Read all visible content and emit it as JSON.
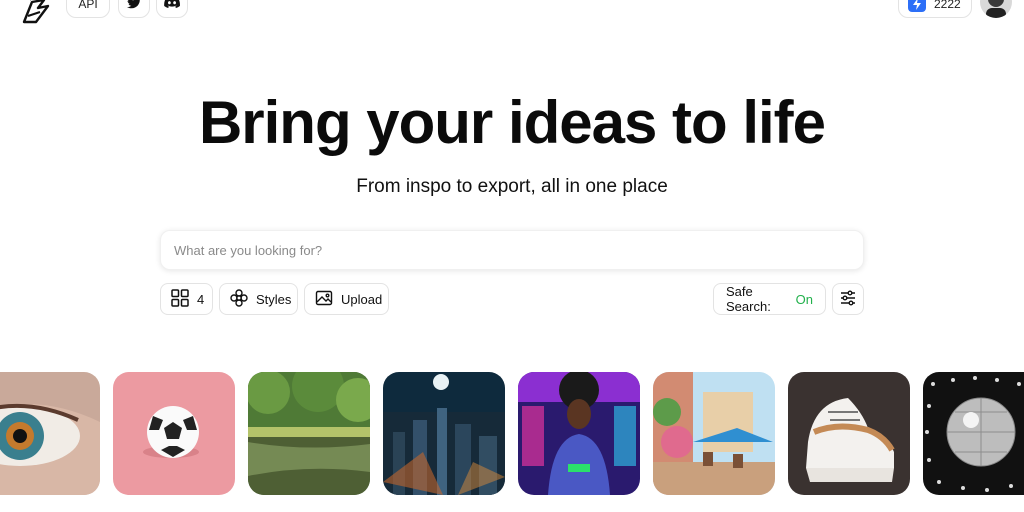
{
  "nav": {
    "api_label": "API",
    "twitter_icon": "twitter-icon",
    "discord_icon": "discord-icon",
    "credits": "2222",
    "credits_icon": "lightning-icon"
  },
  "hero": {
    "title": "Bring your ideas to life",
    "subtitle": "From inspo to export, all in one place"
  },
  "search": {
    "placeholder": "What are you looking for?",
    "value": ""
  },
  "toolbar": {
    "count": "4",
    "styles_label": "Styles",
    "upload_label": "Upload",
    "safe_search_label": "Safe Search:",
    "safe_search_value": "On"
  },
  "colors": {
    "accent_blue": "#2d6ff7",
    "safe_on_green": "#22b14c"
  },
  "gallery": [
    "eye",
    "soccer ball",
    "lake forest",
    "night city",
    "neon portrait",
    "cafe street",
    "sneaker",
    "disco ball"
  ]
}
